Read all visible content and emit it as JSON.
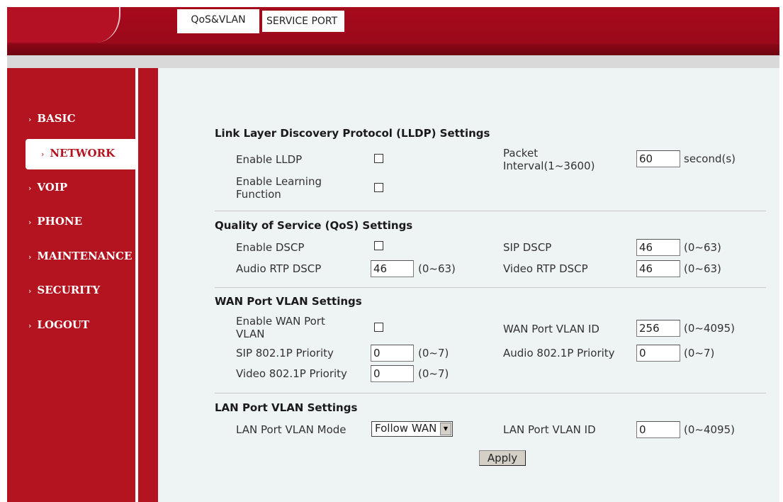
{
  "tabs": [
    "QoS&VLAN",
    "SERVICE PORT"
  ],
  "sidebar": {
    "items": [
      {
        "label": "BASIC"
      },
      {
        "label": "NETWORK"
      },
      {
        "label": "VOIP"
      },
      {
        "label": "PHONE"
      },
      {
        "label": "MAINTENANCE"
      },
      {
        "label": "SECURITY"
      },
      {
        "label": "LOGOUT"
      }
    ],
    "active": "NETWORK",
    "arrow": "›"
  },
  "lldp": {
    "title": "Link Layer Discovery Protocol (LLDP) Settings",
    "enable_label": "Enable LLDP",
    "learning_label_1": "Enable Learning",
    "learning_label_2": "Function",
    "interval_label_1": "Packet",
    "interval_label_2": "Interval(1~3600)",
    "interval_value": "60",
    "interval_unit": "second(s)"
  },
  "qos": {
    "title": "Quality of Service (QoS) Settings",
    "dscp_label": "Enable DSCP",
    "sip_dscp_label": "SIP DSCP",
    "sip_dscp_value": "46",
    "sip_dscp_range": "(0~63)",
    "audio_label": "Audio RTP DSCP",
    "audio_value": "46",
    "audio_range": "(0~63)",
    "video_label": "Video RTP DSCP",
    "video_value": "46",
    "video_range": "(0~63)"
  },
  "wan": {
    "title": "WAN Port VLAN Settings",
    "enable_label_1": "Enable WAN Port",
    "enable_label_2": "VLAN",
    "vlan_id_label": "WAN Port VLAN ID",
    "vlan_id_value": "256",
    "vlan_id_range": "(0~4095)",
    "sip_label": "SIP 802.1P Priority",
    "sip_value": "0",
    "sip_range": "(0~7)",
    "audio_label": "Audio 802.1P Priority",
    "audio_value": "0",
    "audio_range": "(0~7)",
    "video_label": "Video 802.1P Priority",
    "video_value": "0",
    "video_range": "(0~7)"
  },
  "lan": {
    "title": "LAN Port VLAN Settings",
    "mode_label": "LAN Port VLAN Mode",
    "mode_value": "Follow WAN",
    "vlan_id_label": "LAN Port VLAN ID",
    "vlan_id_value": "0",
    "vlan_id_range": "(0~4095)"
  },
  "apply_label": "Apply",
  "colors": {
    "brand": "#a70b1d",
    "content_bg": "#eef3f3"
  }
}
